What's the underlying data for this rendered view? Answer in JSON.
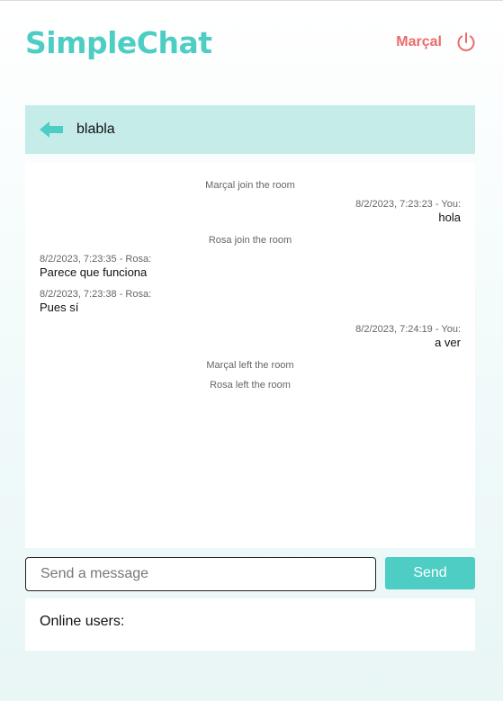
{
  "app": {
    "title": "SimpleChat"
  },
  "header": {
    "username": "Marçal",
    "logout_icon": "power-icon"
  },
  "room": {
    "name": "blabla",
    "back_icon": "arrow-left-icon"
  },
  "messages": [
    {
      "type": "system",
      "text": "Marçal join the room"
    },
    {
      "type": "own",
      "meta": "8/2/2023, 7:23:23 - You:",
      "text": "hola"
    },
    {
      "type": "system",
      "text": "Rosa join the room"
    },
    {
      "type": "other",
      "meta": "8/2/2023, 7:23:35 - Rosa:",
      "text": "Parece que funciona"
    },
    {
      "type": "other",
      "meta": "8/2/2023, 7:23:38 - Rosa:",
      "text": "Pues sí"
    },
    {
      "type": "own",
      "meta": "8/2/2023, 7:24:19 - You:",
      "text": "a ver"
    },
    {
      "type": "system",
      "text": "Marçal left the room"
    },
    {
      "type": "system",
      "text": "Rosa left the room"
    }
  ],
  "composer": {
    "placeholder": "Send a message",
    "value": "",
    "send_label": "Send"
  },
  "online": {
    "label": "Online users:",
    "users": []
  },
  "colors": {
    "accent": "#4ecdc4",
    "user": "#ec6b6b",
    "room_bar": "#c6ecea"
  }
}
